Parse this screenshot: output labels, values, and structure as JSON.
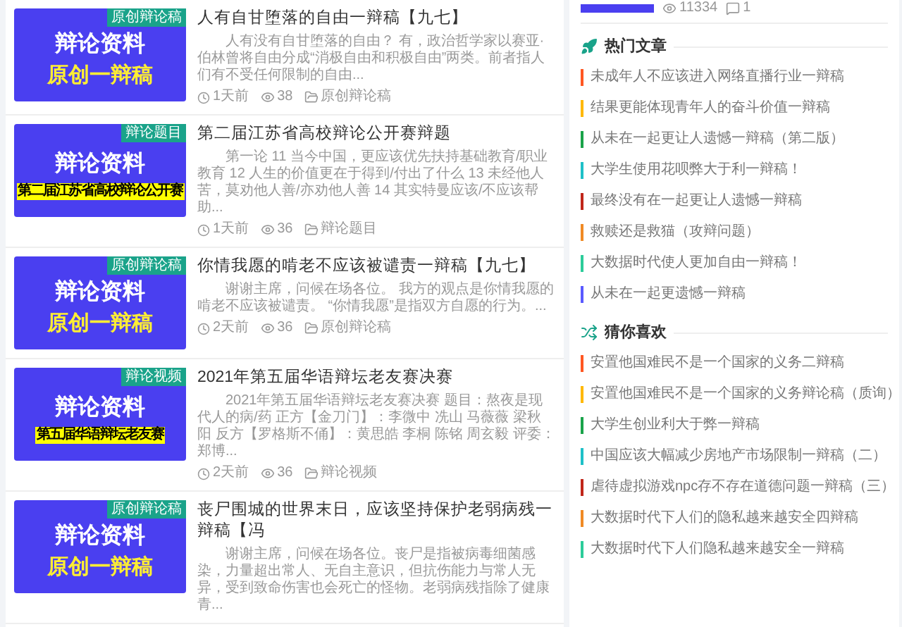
{
  "posts": [
    {
      "thumb": {
        "title": "辩论资料",
        "subtitle": "原创一辩稿",
        "kind": "banner",
        "tag": "原创辩论稿"
      },
      "title": "人有自甘堕落的自由一辩稿【九七】",
      "excerpt": "人有没有自甘堕落的自由？ 有，政治哲学家以赛亚·伯林曾将自由分成“消极自由和积极自由”两类。前者指人们有不受任何限制的自由...",
      "time": "1天前",
      "views": "38",
      "category": "原创辩论稿"
    },
    {
      "thumb": {
        "title": "辩论资料",
        "subtitle": "第二届江苏省高校辩论公开赛",
        "kind": "highlight",
        "tag": "辩论题目"
      },
      "title": "第二届江苏省高校辩论公开赛辩题",
      "excerpt": "第一论 11 当今中国，更应该优先扶持基础教育/职业教育 12 人生的价值更在于得到/付出了什么 13 未经他人苦，莫劝他人善/亦劝他人善 14 其实特曼应该/不应该帮助...",
      "time": "1天前",
      "views": "36",
      "category": "辩论题目"
    },
    {
      "thumb": {
        "title": "辩论资料",
        "subtitle": "原创一辩稿",
        "kind": "banner",
        "tag": "原创辩论稿"
      },
      "title": "你情我愿的啃老不应该被谴责一辩稿【九七】",
      "excerpt": "谢谢主席，问候在场各位。 我方的观点是你情我愿的啃老不应该被谴责。 “你情我愿”是指双方自愿的行为。...",
      "time": "2天前",
      "views": "36",
      "category": "原创辩论稿"
    },
    {
      "thumb": {
        "title": "辩论资料",
        "subtitle": "第五届华语辩坛老友赛",
        "kind": "highlight",
        "tag": "辩论视频"
      },
      "title": "2021年第五届华语辩坛老友赛决赛",
      "excerpt": "2021年第五届华语辩坛老友赛决赛 题目：熬夜是现代人的病/药 正方【金刀门】：李微中 冼山 马薇薇 梁秋阳 反方【罗格斯不俑】：黄思皓 李桐 陈铭 周玄毅 评委：郑博...",
      "time": "2天前",
      "views": "36",
      "category": "辩论视频"
    },
    {
      "thumb": {
        "title": "辩论资料",
        "subtitle": "原创一辩稿",
        "kind": "banner",
        "tag": "原创辩论稿"
      },
      "title": "丧尸围城的世界末日，应该坚持保护老弱病残一辩稿【冯",
      "excerpt": "谢谢主席，问候在场各位。丧尸是指被病毒细菌感染，力量超出常人、无自主意识，但抗伤能力与常人无异，受到致命伤害也会死亡的怪物。老弱病残指除了健康青..."
    }
  ],
  "sidebar": {
    "top_card": {
      "views": "11334",
      "comments": "1"
    },
    "sections": [
      {
        "kind": "hot",
        "title": "热门文章",
        "items": [
          {
            "text": "未成年人不应该进入网络直播行业一辩稿",
            "color": "#ff5722"
          },
          {
            "text": "结果更能体现青年人的奋斗价值一辩稿",
            "color": "#ffb800"
          },
          {
            "text": "从未在一起更让人遗憾一辩稿（第二版）",
            "color": "#1aa34a"
          },
          {
            "text": "大学生使用花呗弊大于利一辩稿！",
            "color": "#1fc0c8"
          },
          {
            "text": "最终没有在一起更让人遗憾一辩稿",
            "color": "#c0261a"
          },
          {
            "text": "救赎还是救猫（攻辩问题）",
            "color": "#f08a24"
          },
          {
            "text": "大数据时代使人更加自由一辩稿！",
            "color": "#2ccc9a"
          },
          {
            "text": "从未在一起更遗憾一辩稿",
            "color": "#5a5aff"
          }
        ]
      },
      {
        "kind": "guess",
        "title": "猜你喜欢",
        "items": [
          {
            "text": "安置他国难民不是一个国家的义务二辩稿",
            "color": "#ff5722"
          },
          {
            "text": "安置他国难民不是一个国家的义务辩论稿（质询）",
            "color": "#ffb800"
          },
          {
            "text": "大学生创业利大于弊一辩稿",
            "color": "#1aa34a"
          },
          {
            "text": "中国应该大幅减少房地产市场限制一辩稿（二）",
            "color": "#1fc0c8"
          },
          {
            "text": "虐待虚拟游戏npc存不存在道德问题一辩稿（三）",
            "color": "#c0261a"
          },
          {
            "text": "大数据时代下人们的隐私越来越安全四辩稿",
            "color": "#f08a24"
          },
          {
            "text": "大数据时代下人们隐私越来越安全一辩稿",
            "color": "#2ccc9a"
          }
        ]
      }
    ]
  }
}
